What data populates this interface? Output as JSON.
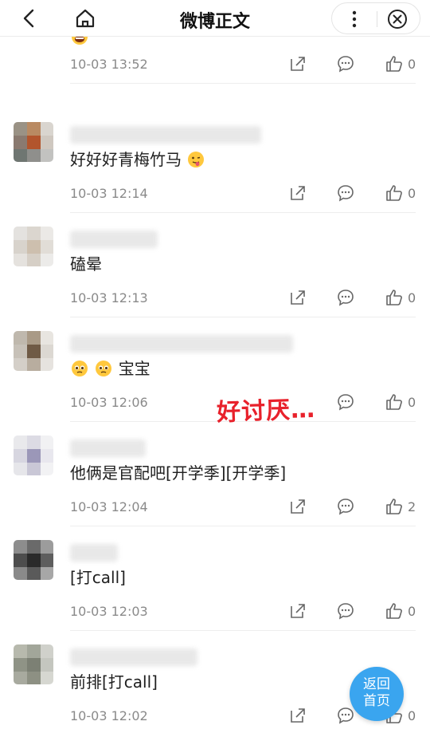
{
  "header": {
    "title": "微博正文",
    "back_icon": "chevron-left-icon",
    "home_icon": "home-icon",
    "more_icon": "more-vertical-icon",
    "close_icon": "close-circle-icon"
  },
  "comments": [
    {
      "text": "",
      "emoji": [
        "grimace"
      ],
      "time": "10-03 13:52",
      "likes": "0"
    },
    {
      "text": "好好好青梅竹马",
      "emoji_after": [
        "tongue"
      ],
      "time": "10-03 12:14",
      "likes": "0"
    },
    {
      "text": "磕晕",
      "time": "10-03 12:13",
      "likes": "0"
    },
    {
      "text": "宝宝",
      "emoji_before": [
        "pleading",
        "pleading"
      ],
      "time": "10-03 12:06",
      "likes": "0"
    },
    {
      "text": "他俩是官配吧[开学季][开学季]",
      "time": "10-03 12:04",
      "likes": "2"
    },
    {
      "text": "[打call]",
      "time": "10-03 12:03",
      "likes": "0"
    },
    {
      "text": "前排[打call]",
      "time": "10-03 12:02",
      "likes": "0"
    }
  ],
  "annotation": {
    "text": "好讨厌…",
    "color": "#e8212b"
  },
  "home_button": {
    "line1": "返回",
    "line2": "首页",
    "color": "#3aa5ef"
  }
}
